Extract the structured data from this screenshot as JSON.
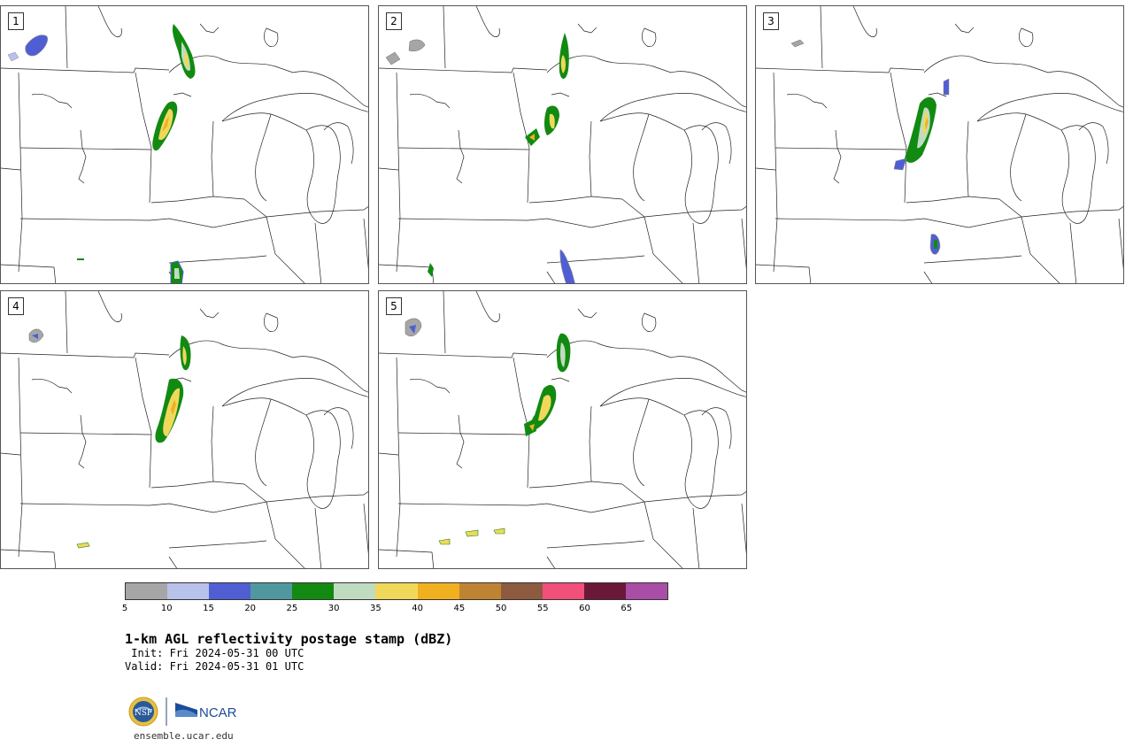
{
  "panels": [
    {
      "label": "1"
    },
    {
      "label": "2"
    },
    {
      "label": "3"
    },
    {
      "label": "4"
    },
    {
      "label": "5"
    }
  ],
  "colorbar": {
    "colors": [
      "#a6a6a6",
      "#b8c2ea",
      "#4f5fd3",
      "#51989e",
      "#128a12",
      "#c0dcc0",
      "#f0d85a",
      "#f0b020",
      "#bf8433",
      "#8e5a3f",
      "#f0507a",
      "#6a1838",
      "#a94ea6"
    ],
    "ticks": [
      "5",
      "10",
      "15",
      "20",
      "25",
      "30",
      "35",
      "40",
      "45",
      "50",
      "55",
      "60",
      "65"
    ]
  },
  "title": "1-km AGL reflectivity postage stamp (dBZ)",
  "init_text": " Init: Fri 2024-05-31 00 UTC",
  "valid_text": "Valid: Fri 2024-05-31 01 UTC",
  "logos": {
    "nsf": "NSF",
    "ncar": "NCAR"
  },
  "website": "ensemble.ucar.edu"
}
